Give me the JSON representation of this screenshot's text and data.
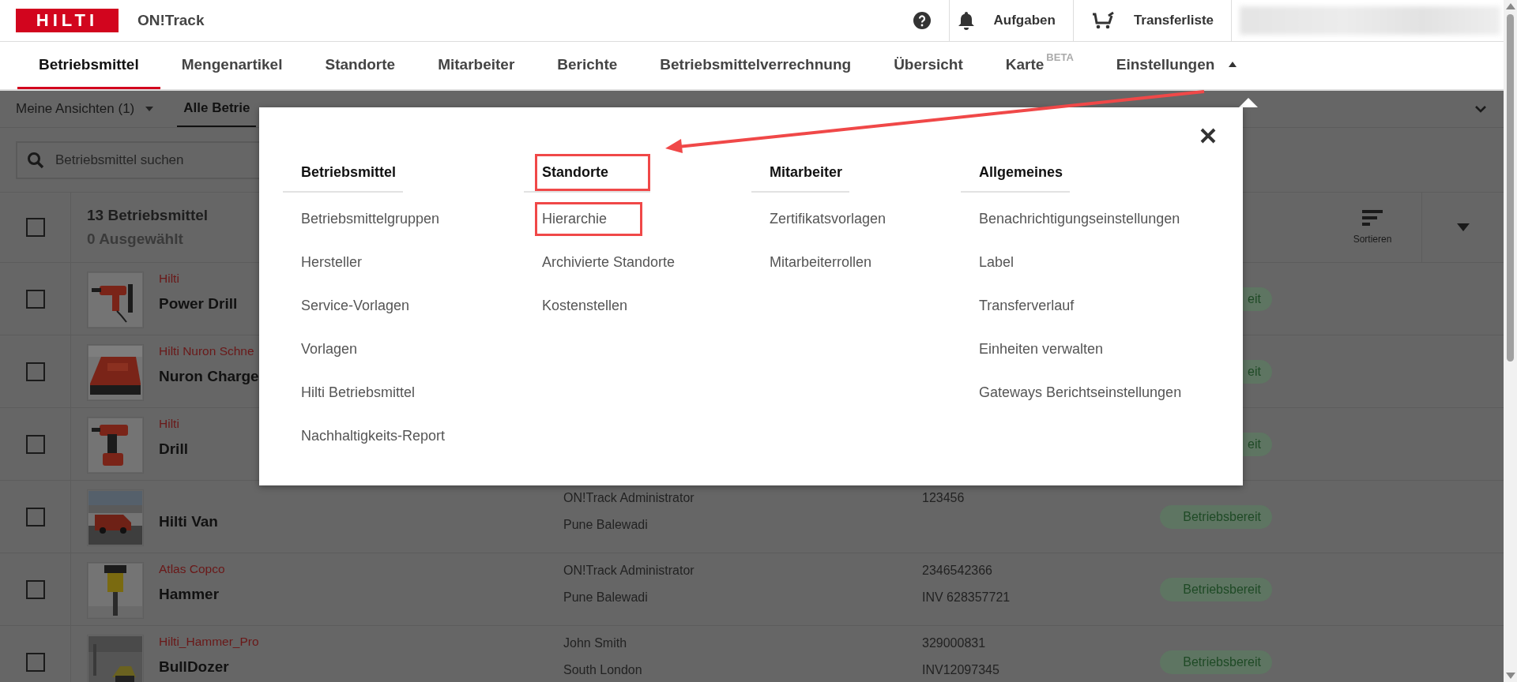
{
  "header": {
    "logo": "HILTI",
    "app_name": "ON!Track",
    "actions": [
      {
        "kind": "bell",
        "label": "Aufgaben"
      },
      {
        "kind": "cart",
        "label": "Transferliste"
      }
    ]
  },
  "nav": {
    "tabs": [
      {
        "label": "Betriebsmittel",
        "selected": true
      },
      {
        "label": "Mengenartikel",
        "selected": false
      },
      {
        "label": "Standorte",
        "selected": false
      },
      {
        "label": "Mitarbeiter",
        "selected": false
      },
      {
        "label": "Berichte",
        "selected": false
      },
      {
        "label": "Betriebsmittelverrechnung",
        "selected": false
      },
      {
        "label": "Übersicht",
        "selected": false
      },
      {
        "label": "Karte",
        "badge": "BETA",
        "selected": false
      },
      {
        "label": "Einstellungen",
        "selected": false,
        "expanded": true
      }
    ]
  },
  "views_bar": {
    "my_views": "Meine Ansichten (1)",
    "current_view": "Alle Betrie"
  },
  "search": {
    "placeholder": "Betriebsmittel suchen"
  },
  "list_header": {
    "checked": false,
    "count": "13 Betriebsmittel",
    "selected_count": "0 Ausgewählt",
    "sort_label": "Sortieren"
  },
  "rows": [
    {
      "checked": false,
      "brand": "Hilti",
      "name": "Power Drill",
      "status": "eit"
    },
    {
      "checked": false,
      "brand": "Hilti Nuron Schne",
      "name": "Nuron Charge",
      "status": "eit"
    },
    {
      "checked": false,
      "brand": "Hilti",
      "name": "Drill",
      "status": "eit"
    },
    {
      "checked": false,
      "name": "Hilti Van",
      "person": "ON!Track Administrator",
      "location": "Pune Balewadi",
      "number": "123456",
      "status": "Betriebsbereit"
    },
    {
      "checked": false,
      "brand": "Atlas Copco",
      "name": "Hammer",
      "person": "ON!Track Administrator",
      "location": "Pune Balewadi",
      "number": "2346542366",
      "inventory": "INV 628357721",
      "status": "Betriebsbereit"
    },
    {
      "checked": false,
      "brand": "Hilti_Hammer_Pro",
      "name": "BullDozer",
      "person": "John Smith",
      "location": "South London",
      "number": "329000831",
      "inventory": "INV12097345",
      "status": "Betriebsbereit"
    }
  ],
  "settings_menu": {
    "columns": [
      {
        "title": "Betriebsmittel",
        "highlighted": false,
        "items": [
          {
            "label": "Betriebsmittelgruppen",
            "highlighted": false
          },
          {
            "label": "Hersteller",
            "highlighted": false
          },
          {
            "label": "Service-Vorlagen",
            "highlighted": false
          },
          {
            "label": "Vorlagen",
            "highlighted": false
          },
          {
            "label": "Hilti Betriebsmittel",
            "highlighted": false
          },
          {
            "label": "Nachhaltigkeits-Report",
            "highlighted": false
          }
        ]
      },
      {
        "title": "Standorte",
        "highlighted": true,
        "items": [
          {
            "label": "Hierarchie",
            "highlighted": true
          },
          {
            "label": "Archivierte Standorte",
            "highlighted": false
          },
          {
            "label": "Kostenstellen",
            "highlighted": false
          }
        ]
      },
      {
        "title": "Mitarbeiter",
        "highlighted": false,
        "items": [
          {
            "label": "Zertifikatsvorlagen",
            "highlighted": false
          },
          {
            "label": "Mitarbeiterrollen",
            "highlighted": false
          }
        ]
      },
      {
        "title": "Allgemeines",
        "highlighted": false,
        "items": [
          {
            "label": "Benachrichtigungseinstellungen",
            "highlighted": false
          },
          {
            "label": "Label",
            "highlighted": false
          },
          {
            "label": "Transferverlauf",
            "highlighted": false
          },
          {
            "label": "Einheiten verwalten",
            "highlighted": false
          },
          {
            "label": "Gateways Berichtseinstellungen",
            "highlighted": false
          }
        ]
      }
    ]
  }
}
